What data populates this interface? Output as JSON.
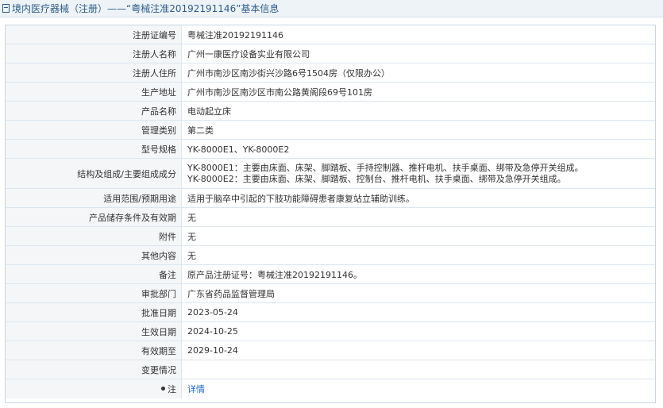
{
  "header": {
    "title": "境内医疗器械（注册）——“粤械注准20192191146”基本信息"
  },
  "fields": [
    {
      "label": "注册证编号",
      "value": "粤械注准20192191146"
    },
    {
      "label": "注册人名称",
      "value": "广州一康医疗设备实业有限公司"
    },
    {
      "label": "注册人住所",
      "value": "广州市南沙区南沙街兴沙路6号1504房（仅限办公）"
    },
    {
      "label": "生产地址",
      "value": "广州市南沙区南沙区市南公路黄阁段69号101房"
    },
    {
      "label": "产品名称",
      "value": "电动起立床"
    },
    {
      "label": "管理类别",
      "value": "第二类"
    },
    {
      "label": "型号规格",
      "value": "YK-8000E1、YK-8000E2"
    },
    {
      "label": "结构及组成/主要组成成分",
      "value_line1": "YK-8000E1：主要由床面、床架、脚踏板、手持控制器、推杆电机、扶手桌面、绑带及急停开关组成。",
      "value_line2": "YK-8000E2：主要由床面、床架、脚踏板、控制台、推杆电机、扶手桌面、绑带及急停开关组成。"
    },
    {
      "label": "适用范围/预期用途",
      "value": "适用于脑卒中引起的下肢功能障碍患者康复站立辅助训练。"
    },
    {
      "label": "产品储存条件及有效期",
      "value": "无"
    },
    {
      "label": "附件",
      "value": "无"
    },
    {
      "label": "其他内容",
      "value": "无"
    },
    {
      "label": "备注",
      "value": "原产品注册证号：粤械注准20192191146。"
    },
    {
      "label": "审批部门",
      "value": "广东省药品监督管理局"
    },
    {
      "label": "批准日期",
      "value": "2023-05-24"
    },
    {
      "label": "生效日期",
      "value": "2024-10-25"
    },
    {
      "label": "有效期至",
      "value": "2029-10-24"
    },
    {
      "label": "变更情况",
      "value": ""
    },
    {
      "label": "注",
      "value": "详情"
    }
  ],
  "icons": {
    "header_icon": "document-icon",
    "note_icon": "tip-dot-icon"
  }
}
